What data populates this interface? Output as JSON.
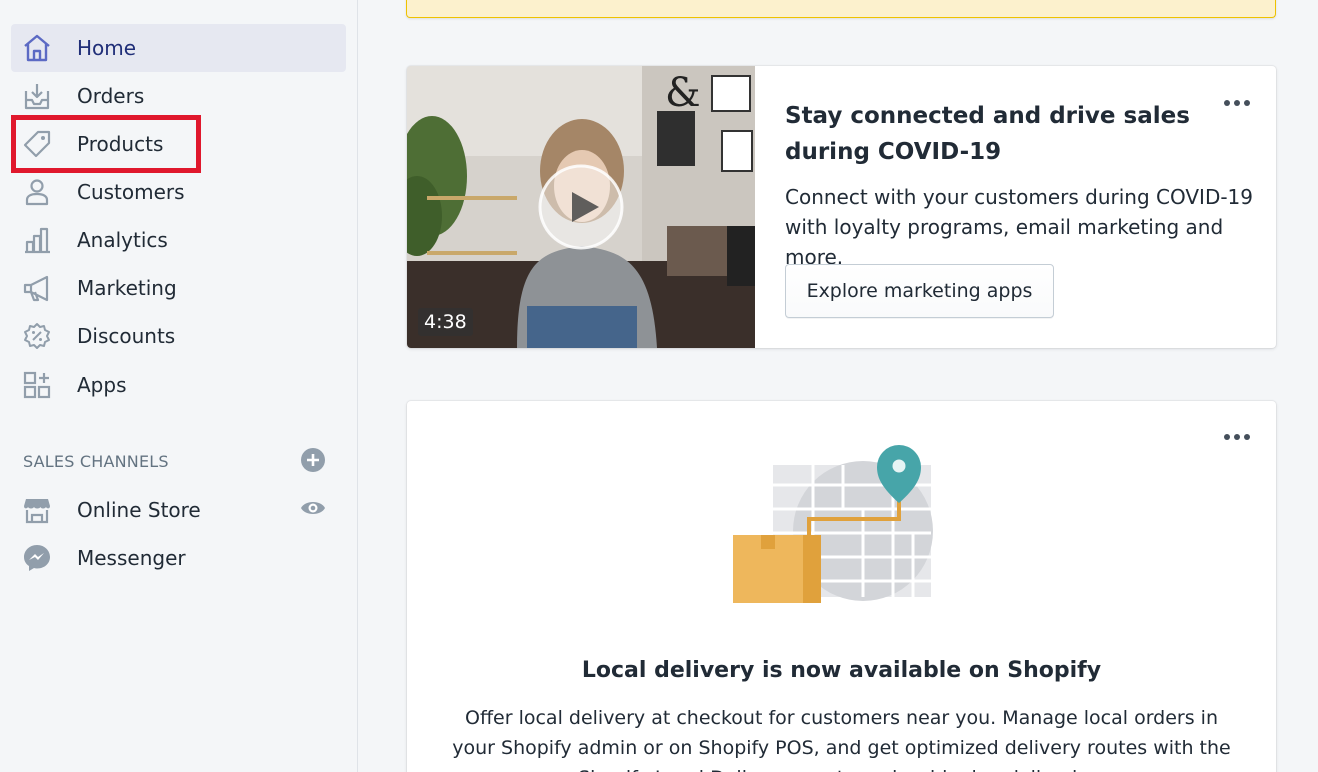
{
  "sidebar": {
    "items": [
      {
        "label": "Home",
        "icon": "home-icon",
        "active": true
      },
      {
        "label": "Orders",
        "icon": "orders-icon"
      },
      {
        "label": "Products",
        "icon": "tag-icon"
      },
      {
        "label": "Customers",
        "icon": "person-icon"
      },
      {
        "label": "Analytics",
        "icon": "bar-chart-icon"
      },
      {
        "label": "Marketing",
        "icon": "megaphone-icon"
      },
      {
        "label": "Discounts",
        "icon": "discount-badge-icon"
      },
      {
        "label": "Apps",
        "icon": "apps-grid-icon"
      }
    ],
    "sales_channels_title": "SALES CHANNELS",
    "channels": [
      {
        "label": "Online Store",
        "icon": "store-icon",
        "action_icon": "eye-icon"
      },
      {
        "label": "Messenger",
        "icon": "messenger-icon"
      }
    ],
    "add_channel_icon": "plus-circle-icon"
  },
  "video_card": {
    "title": "Stay connected and drive sales during COVID-19",
    "body": "Connect with your customers during COVID-19 with loyalty programs, email marketing and more.",
    "button_label": "Explore marketing apps",
    "video_duration": "4:38",
    "menu_icon": "more-horizontal-icon"
  },
  "delivery_card": {
    "title": "Local delivery is now available on Shopify",
    "body": "Offer local delivery at checkout for customers near you. Manage local orders in your Shopify admin or on Shopify POS, and get optimized delivery routes with the Shopify Local Delivery app to make shipping deliveries.",
    "menu_icon": "more-horizontal-icon"
  },
  "colors": {
    "accent": "#202e78",
    "highlight": "#e0182d",
    "icon": "#637381",
    "teal_pin": "#47a5a9",
    "box": "#e8ac51"
  }
}
